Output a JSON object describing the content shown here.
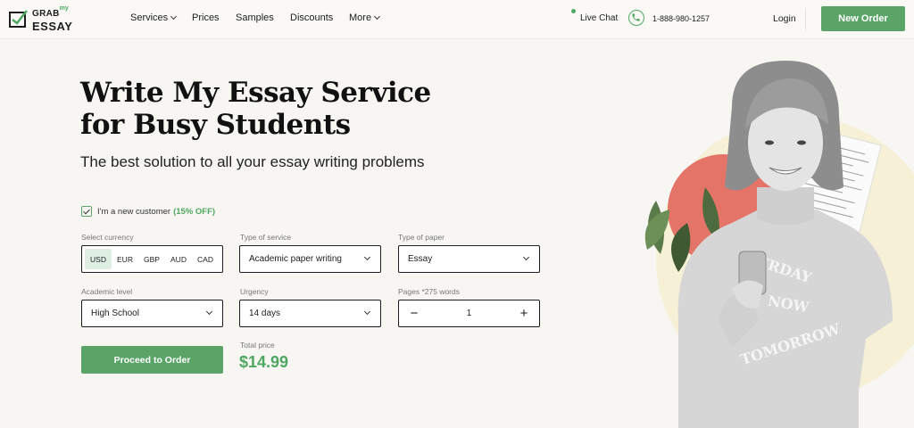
{
  "logo": {
    "line1": "GRAB",
    "my": "my",
    "line2": "ESSAY"
  },
  "nav": {
    "services": "Services",
    "prices": "Prices",
    "samples": "Samples",
    "discounts": "Discounts",
    "more": "More",
    "live_chat": "Live Chat",
    "phone": "1-888-980-1257",
    "login": "Login",
    "new_order": "New Order"
  },
  "hero": {
    "title_line1": "Write My Essay Service",
    "title_line2": "for Busy Students",
    "subtitle": "The best solution to all your essay writing problems"
  },
  "form": {
    "new_customer_label": "I'm a new customer",
    "new_customer_offer": "(15% OFF)",
    "new_customer_checked": true,
    "currency": {
      "label": "Select currency",
      "options": [
        "USD",
        "EUR",
        "GBP",
        "AUD",
        "CAD"
      ],
      "selected": "USD"
    },
    "service": {
      "label": "Type of service",
      "value": "Academic paper writing"
    },
    "paper": {
      "label": "Type of paper",
      "value": "Essay"
    },
    "level": {
      "label": "Academic level",
      "value": "High School"
    },
    "urgency": {
      "label": "Urgency",
      "value": "14 days"
    },
    "pages": {
      "label": "Pages *275 words",
      "value": "1",
      "minus": "−",
      "plus": "+"
    },
    "proceed": "Proceed to Order",
    "total_label": "Total price",
    "total_value": "$14.99"
  },
  "colors": {
    "accent": "#5aa468",
    "price_green": "#4fa862",
    "background": "#f7f6f3",
    "circle_yellow": "#f6f0d6",
    "circle_red": "#e57468"
  },
  "icons": [
    "logo-check-icon",
    "chevron-down-icon",
    "phone-icon",
    "live-status-dot",
    "checkmark-icon",
    "minus-icon",
    "plus-icon"
  ]
}
